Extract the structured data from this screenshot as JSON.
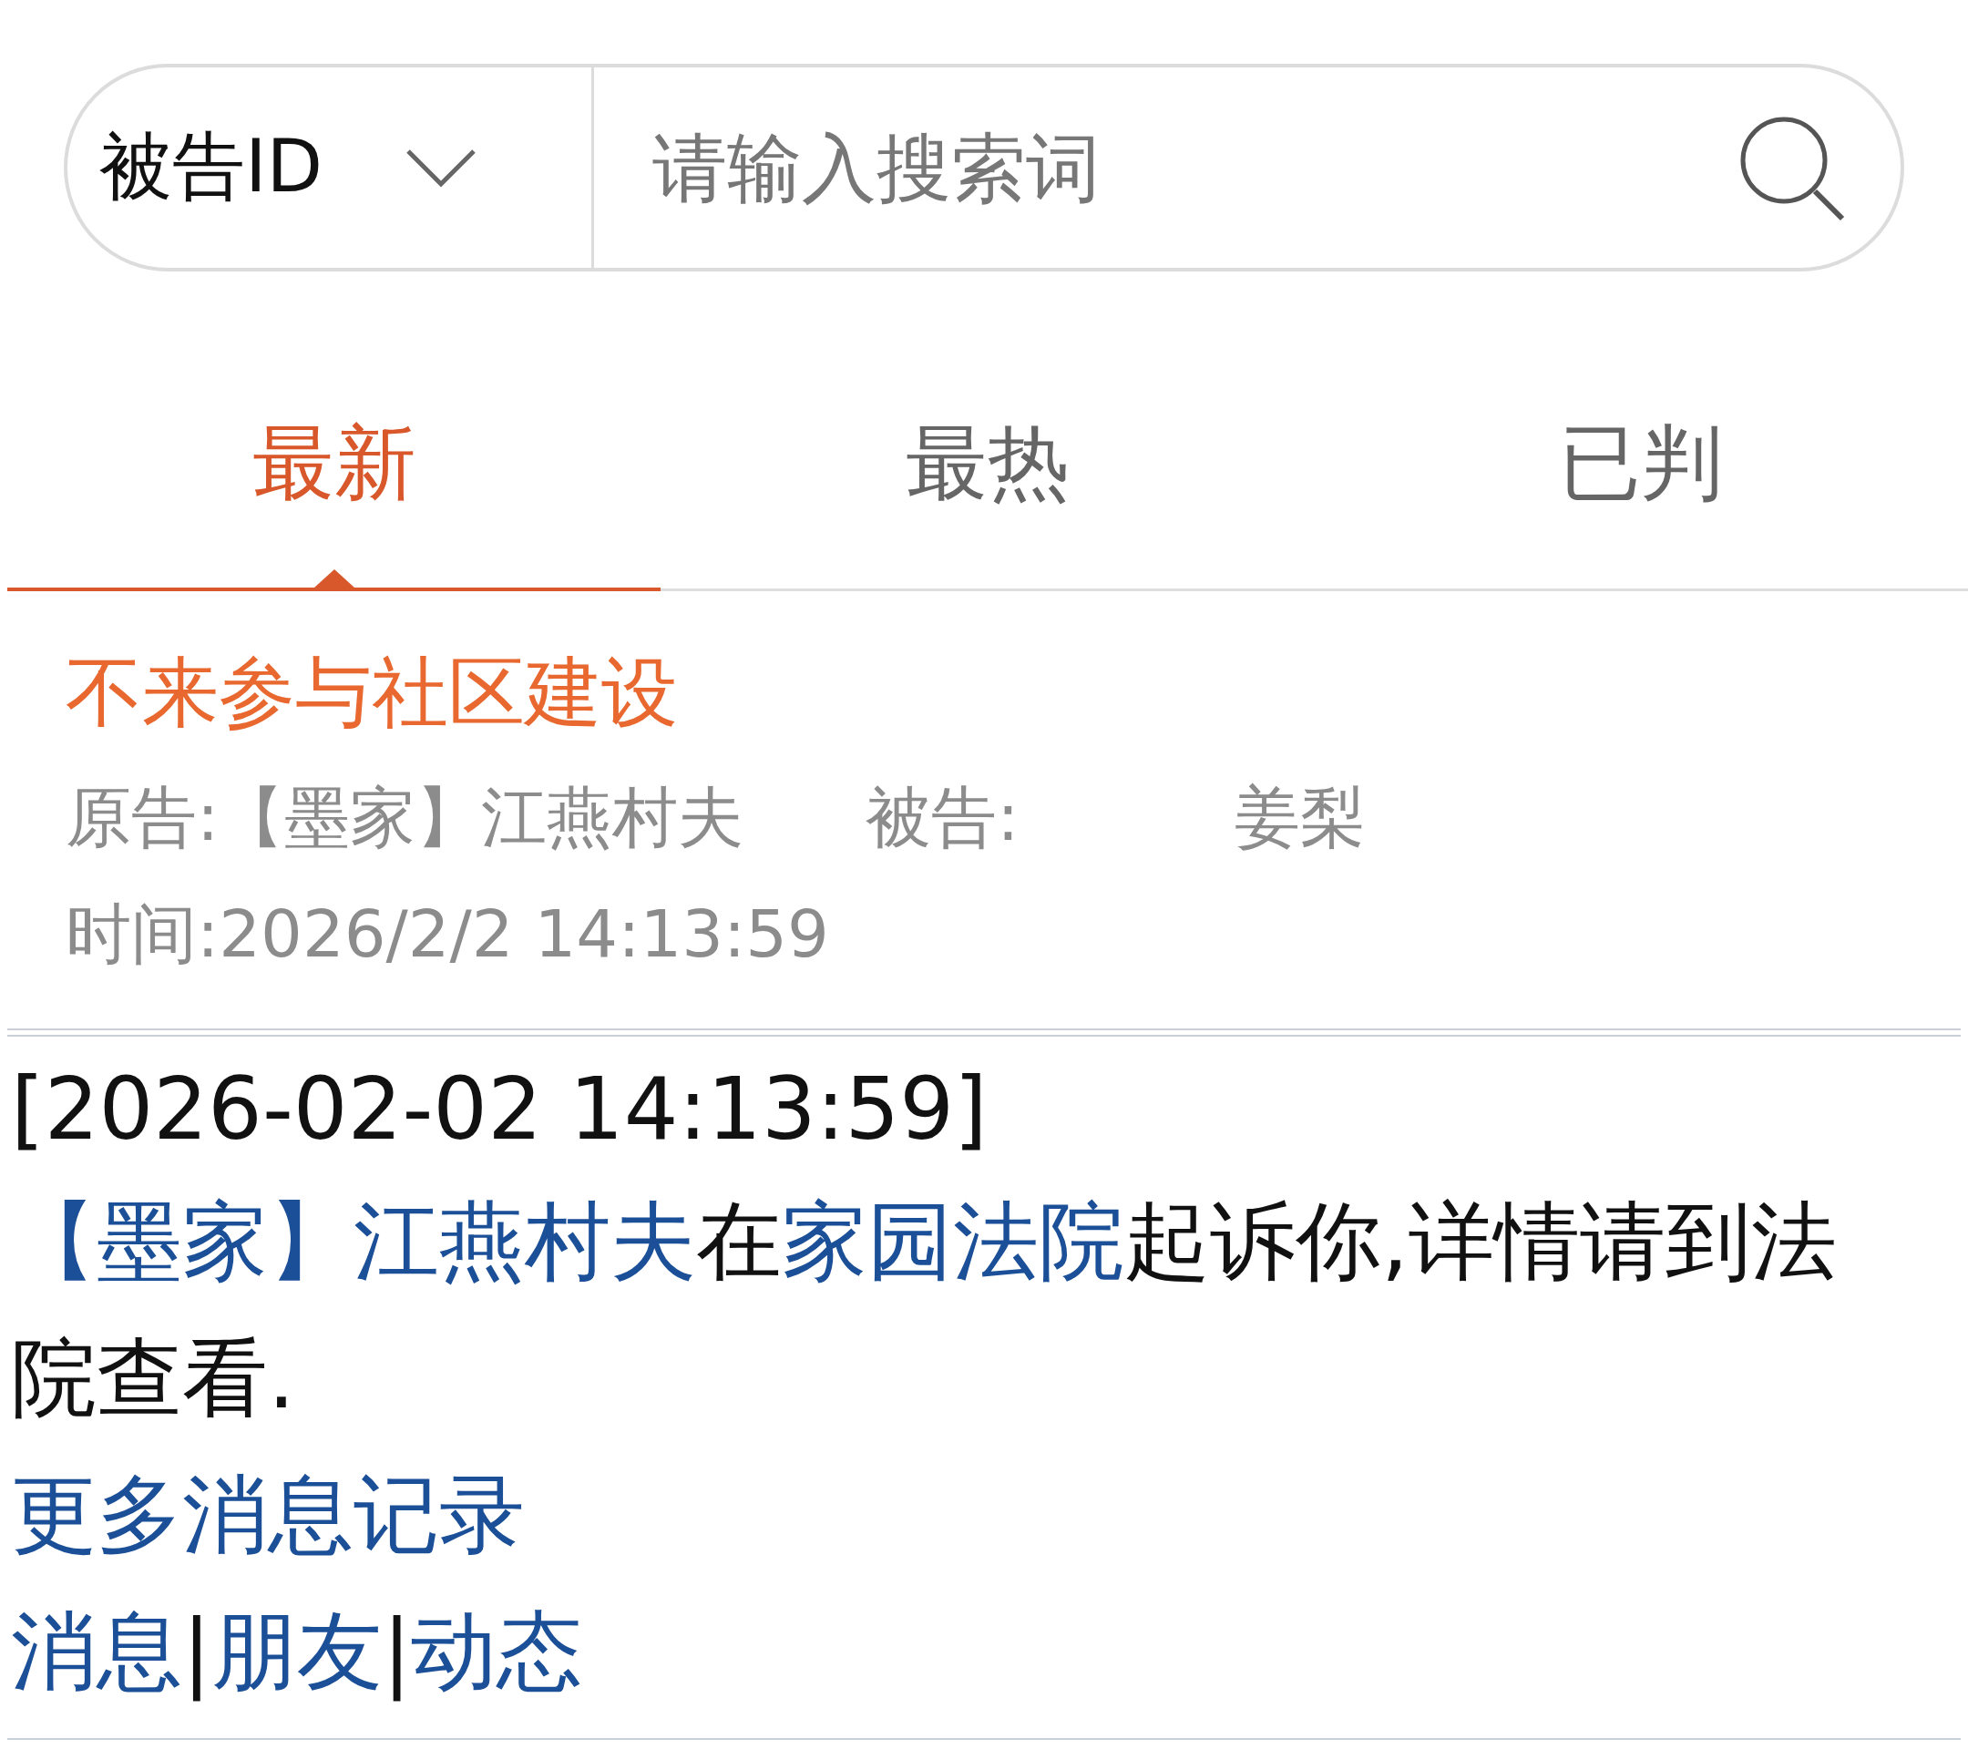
{
  "search": {
    "scope": "被告ID",
    "placeholder": "请输入搜索词"
  },
  "tabs": [
    {
      "label": "最新",
      "selected": true
    },
    {
      "label": "最热",
      "selected": false
    },
    {
      "label": "已判",
      "selected": false
    }
  ],
  "case": {
    "title": "不来参与社区建设",
    "plaintiff_label": "原告:",
    "plaintiff": "【墨家】江燕村夫",
    "defendant_label": "被告:",
    "defendant": "姜梨",
    "time": "时间:2026/2/2 14:13:59"
  },
  "message": {
    "timestamp": "[2026-02-02 14:13:59]",
    "parts": [
      {
        "kind": "link",
        "text": "【墨家】江燕村夫"
      },
      {
        "kind": "text",
        "text": "在"
      },
      {
        "kind": "link",
        "text": "家园法院"
      },
      {
        "kind": "text",
        "text": "起诉你,详情请到法院查看."
      }
    ]
  },
  "more_link": "更多消息记录",
  "nav": {
    "separator": "|",
    "links": [
      "消息",
      "朋友",
      "动态"
    ]
  }
}
